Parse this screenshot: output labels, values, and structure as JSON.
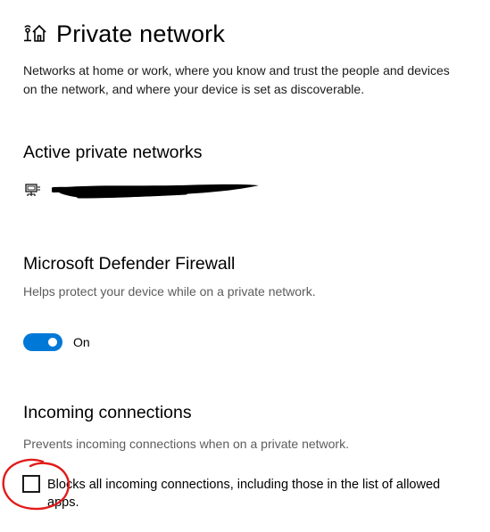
{
  "header": {
    "icon": "home-network-icon",
    "title": "Private network"
  },
  "description": "Networks at home or work, where you know and trust the people and devices on the network, and where your device is set as discoverable.",
  "active_networks": {
    "heading": "Active private networks",
    "icon": "ethernet-icon",
    "name_redacted": true
  },
  "firewall": {
    "heading": "Microsoft Defender Firewall",
    "subtext": "Helps protect your device while on a private network.",
    "toggle_on": true,
    "toggle_label": "On"
  },
  "incoming": {
    "heading": "Incoming connections",
    "subtext": "Prevents incoming connections when on a private network.",
    "checkbox_checked": false,
    "checkbox_label": "Blocks all incoming connections, including those in the list of allowed apps."
  },
  "colors": {
    "accent": "#0078d7",
    "annotation": "#e21b1b",
    "secondary_text": "#5c5c5c"
  }
}
